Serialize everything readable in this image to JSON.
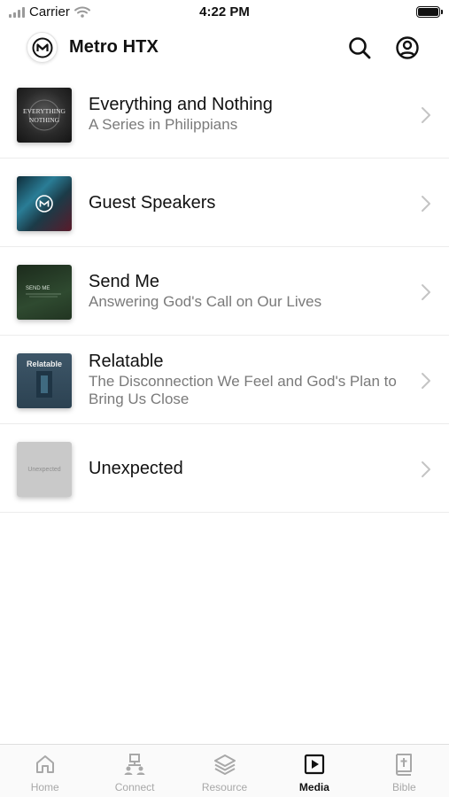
{
  "status_bar": {
    "carrier": "Carrier",
    "time": "4:22 PM"
  },
  "header": {
    "title": "Metro HTX",
    "icons": [
      "search-icon",
      "profile-icon"
    ]
  },
  "series": [
    {
      "title": "Everything and Nothing",
      "subtitle": "A Series in Philippians",
      "thumb_text": "EVERYTHING NOTHING"
    },
    {
      "title": "Guest Speakers",
      "subtitle": "",
      "thumb_text": ""
    },
    {
      "title": "Send Me",
      "subtitle": "Answering God's Call on Our Lives",
      "thumb_text": "SEND ME"
    },
    {
      "title": "Relatable",
      "subtitle": "The Disconnection We Feel and God's Plan to Bring Us Close",
      "thumb_text": "Relatable"
    },
    {
      "title": "Unexpected",
      "subtitle": "",
      "thumb_text": "Unexpected"
    }
  ],
  "tabs": [
    {
      "label": "Home",
      "icon": "home-icon",
      "active": false
    },
    {
      "label": "Connect",
      "icon": "connect-icon",
      "active": false
    },
    {
      "label": "Resource",
      "icon": "layers-icon",
      "active": false
    },
    {
      "label": "Media",
      "icon": "play-icon",
      "active": true
    },
    {
      "label": "Bible",
      "icon": "bible-icon",
      "active": false
    }
  ],
  "colors": {
    "text_primary": "#111111",
    "text_secondary": "#7a7a7a",
    "tab_inactive": "#a8a8a8",
    "divider": "#ececec"
  }
}
